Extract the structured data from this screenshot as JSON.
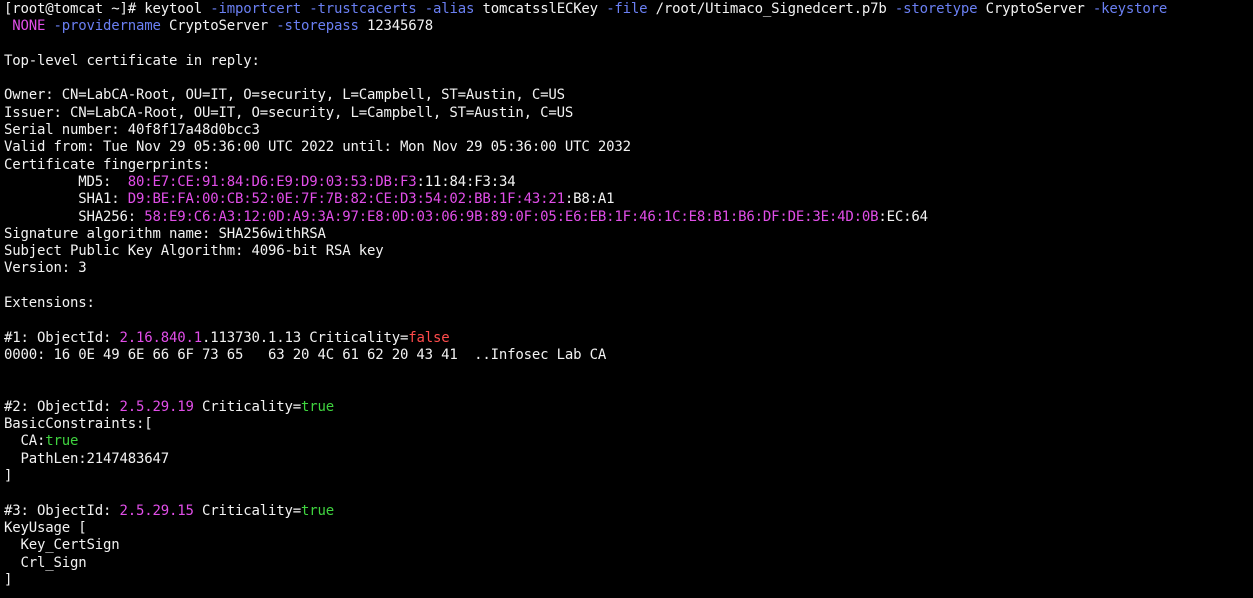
{
  "terminal": {
    "colors": {
      "background": "#000000",
      "default": "#f2f2f2",
      "option_flag": "#6a7ff2",
      "highlight": "#e14ee8",
      "false_value": "#ff4b4b",
      "true_value": "#3fd33f"
    },
    "lines": [
      [
        {
          "t": "[root@tomcat ~]# keytool ",
          "c": "default"
        },
        {
          "t": "-importcert",
          "c": "blue"
        },
        {
          "t": " ",
          "c": "default"
        },
        {
          "t": "-trustcacerts",
          "c": "blue"
        },
        {
          "t": " ",
          "c": "default"
        },
        {
          "t": "-alias",
          "c": "blue"
        },
        {
          "t": " tomcatsslECKey ",
          "c": "default"
        },
        {
          "t": "-file",
          "c": "blue"
        },
        {
          "t": " /root/Utimaco_Signedcert.p7b ",
          "c": "default"
        },
        {
          "t": "-storetype",
          "c": "blue"
        },
        {
          "t": " CryptoServer ",
          "c": "default"
        },
        {
          "t": "-keystore",
          "c": "blue"
        }
      ],
      [
        {
          "t": " ",
          "c": "default"
        },
        {
          "t": "NONE",
          "c": "magenta"
        },
        {
          "t": " ",
          "c": "default"
        },
        {
          "t": "-providername",
          "c": "blue"
        },
        {
          "t": " CryptoServer ",
          "c": "default"
        },
        {
          "t": "-storepass",
          "c": "blue"
        },
        {
          "t": " 12345678",
          "c": "default"
        }
      ],
      [],
      [
        {
          "t": "Top-level certificate in reply:",
          "c": "default"
        }
      ],
      [],
      [
        {
          "t": "Owner: CN=LabCA-Root, OU=IT, O=security, L=Campbell, ST=Austin, C=US",
          "c": "default"
        }
      ],
      [
        {
          "t": "Issuer: CN=LabCA-Root, OU=IT, O=security, L=Campbell, ST=Austin, C=US",
          "c": "default"
        }
      ],
      [
        {
          "t": "Serial number: 40f8f17a48d0bcc3",
          "c": "default"
        }
      ],
      [
        {
          "t": "Valid from: Tue Nov 29 05:36:00 UTC 2022 until: Mon Nov 29 05:36:00 UTC 2032",
          "c": "default"
        }
      ],
      [
        {
          "t": "Certificate fingerprints:",
          "c": "default"
        }
      ],
      [
        {
          "t": "         MD5:  ",
          "c": "default"
        },
        {
          "t": "80:E7:CE:91:84:D6:E9:D9:03:53:DB:F3",
          "c": "magenta"
        },
        {
          "t": ":11:84:F3:34",
          "c": "default"
        }
      ],
      [
        {
          "t": "         SHA1: ",
          "c": "default"
        },
        {
          "t": "D9:BE:FA:00:CB:52:0E:7F:7B:82:CE:D3:54:02:BB:1F:43:21",
          "c": "magenta"
        },
        {
          "t": ":B8:A1",
          "c": "default"
        }
      ],
      [
        {
          "t": "         SHA256: ",
          "c": "default"
        },
        {
          "t": "58:E9:C6:A3:12:0D:A9:3A:97:E8:0D:03:06:9B:89:0F:05:E6:EB:1F:46:1C:E8:B1:B6:DF:DE:3E:4D:0B",
          "c": "magenta"
        },
        {
          "t": ":EC:64",
          "c": "default"
        }
      ],
      [
        {
          "t": "Signature algorithm name: SHA256withRSA",
          "c": "default"
        }
      ],
      [
        {
          "t": "Subject Public Key Algorithm: 4096-bit RSA key",
          "c": "default"
        }
      ],
      [
        {
          "t": "Version: 3",
          "c": "default"
        }
      ],
      [],
      [
        {
          "t": "Extensions:",
          "c": "default"
        }
      ],
      [],
      [
        {
          "t": "#1: ObjectId: ",
          "c": "default"
        },
        {
          "t": "2.16.840.1",
          "c": "magenta"
        },
        {
          "t": ".113730.1.13 Criticality=",
          "c": "default"
        },
        {
          "t": "false",
          "c": "red"
        }
      ],
      [
        {
          "t": "0000: 16 0E 49 6E 66 6F 73 65   63 20 4C 61 62 20 43 41  ..Infosec Lab CA",
          "c": "default"
        }
      ],
      [],
      [],
      [
        {
          "t": "#2: ObjectId: ",
          "c": "default"
        },
        {
          "t": "2.5.29.19",
          "c": "magenta"
        },
        {
          "t": " Criticality=",
          "c": "default"
        },
        {
          "t": "true",
          "c": "green"
        }
      ],
      [
        {
          "t": "BasicConstraints:[",
          "c": "default"
        }
      ],
      [
        {
          "t": "  CA:",
          "c": "default"
        },
        {
          "t": "true",
          "c": "green"
        }
      ],
      [
        {
          "t": "  PathLen:2147483647",
          "c": "default"
        }
      ],
      [
        {
          "t": "]",
          "c": "default"
        }
      ],
      [],
      [
        {
          "t": "#3: ObjectId: ",
          "c": "default"
        },
        {
          "t": "2.5.29.15",
          "c": "magenta"
        },
        {
          "t": " Criticality=",
          "c": "default"
        },
        {
          "t": "true",
          "c": "green"
        }
      ],
      [
        {
          "t": "KeyUsage [",
          "c": "default"
        }
      ],
      [
        {
          "t": "  Key_CertSign",
          "c": "default"
        }
      ],
      [
        {
          "t": "  Crl_Sign",
          "c": "default"
        }
      ],
      [
        {
          "t": "]",
          "c": "default"
        }
      ]
    ]
  }
}
